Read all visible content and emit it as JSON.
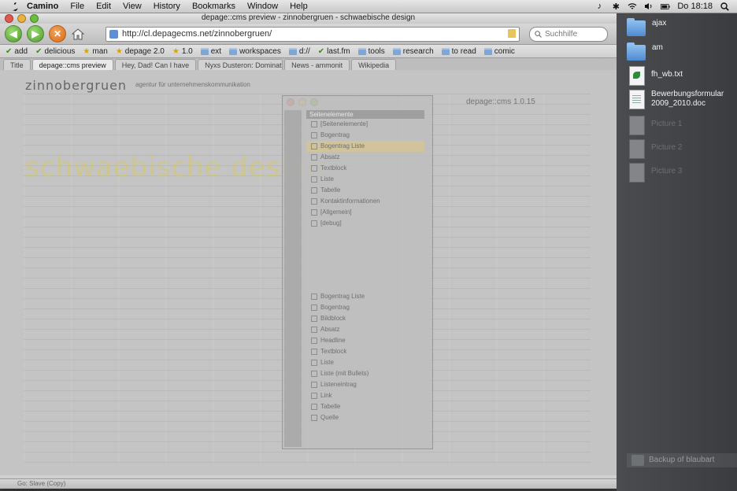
{
  "menubar": {
    "app_name": "Camino",
    "items": [
      "File",
      "Edit",
      "View",
      "History",
      "Bookmarks",
      "Window",
      "Help"
    ],
    "clock": "Do 18:18"
  },
  "browser": {
    "window_title": "depage::cms preview - zinnobergruen - schwaebische design",
    "url": "http://cl.depagecms.net/zinnobergruen/",
    "search_placeholder": "Suchhilfe",
    "bookmarks": [
      {
        "label": "add",
        "icon": "check"
      },
      {
        "label": "delicious",
        "icon": "check"
      },
      {
        "label": "man",
        "icon": "star"
      },
      {
        "label": "depage 2.0",
        "icon": "star"
      },
      {
        "label": "1.0",
        "icon": "star"
      },
      {
        "label": "ext",
        "icon": "folder"
      },
      {
        "label": "workspaces",
        "icon": "folder"
      },
      {
        "label": "d://",
        "icon": "folder"
      },
      {
        "label": "last.fm",
        "icon": "check"
      },
      {
        "label": "tools",
        "icon": "folder"
      },
      {
        "label": "research",
        "icon": "folder"
      },
      {
        "label": "to read",
        "icon": "folder"
      },
      {
        "label": "comic",
        "icon": "folder"
      }
    ],
    "tabs": [
      "Title",
      "depage::cms preview",
      "Hey, Dad! Can I have",
      "Nyxs Dusteron: Dominate",
      "News - ammonit",
      "Wikipedia"
    ],
    "status_text": "Go: Slave (Copy)"
  },
  "page": {
    "brand": "zinnobergruen",
    "brand_sub": "agentur für unternehmenskommunikation",
    "big_title": "schwaebische design",
    "editor_title": "depage::cms 1.0.15",
    "tree_header": "Seitenelemente",
    "tree_items": [
      "[Seitenelemente]",
      "Bogentrag",
      "Bogentrag Liste",
      "Absatz",
      "Textblock",
      "Liste",
      "Tabelle",
      "Kontaktinformationen",
      "[Allgemein]",
      "[debug]"
    ],
    "tree_selected_index": 2,
    "palette_items": [
      "Bogentrag Liste",
      "Bogentrag",
      "Bildblock",
      "Absatz",
      "Headline",
      "Textblock",
      "Liste",
      "Liste (mit Bullets)",
      "Listeneintrag",
      "Link",
      "Tabelle",
      "Quelle"
    ]
  },
  "desktop": {
    "icons": [
      {
        "label": "ajax",
        "type": "folder"
      },
      {
        "label": "am",
        "type": "folder"
      },
      {
        "label": "fh_wb.txt",
        "type": "text"
      },
      {
        "label": "Bewerbungsformular 2009_2010.doc",
        "type": "word"
      },
      {
        "label": "Picture 1",
        "type": "image"
      },
      {
        "label": "Picture 2",
        "type": "image"
      },
      {
        "label": "Picture 3",
        "type": "image"
      }
    ],
    "backup_label": "Backup of blaubart"
  },
  "colors": {
    "accent": "#5b8fd6",
    "brand_title": "#d8c95a",
    "folder": "#7ea7d9"
  }
}
